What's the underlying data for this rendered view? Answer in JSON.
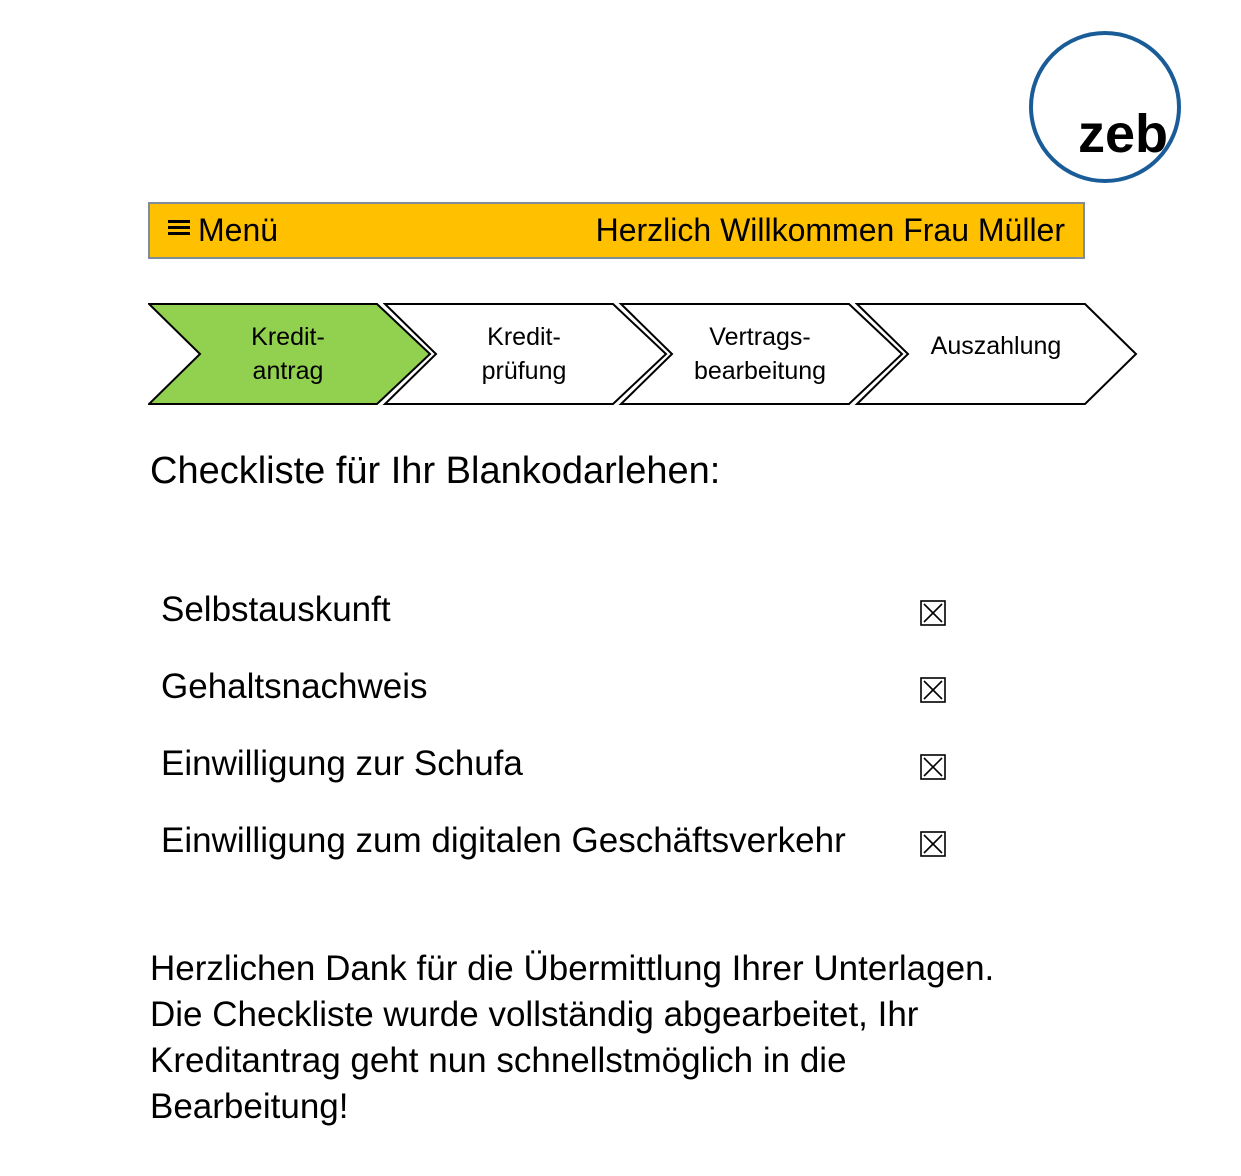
{
  "logo": {
    "text": "zeb",
    "ring_color": "#1a5c97"
  },
  "header": {
    "menu_label": "Menü",
    "welcome_text": "Herzlich Willkommen Frau Müller",
    "background_color": "#ffc000"
  },
  "steps": [
    {
      "label": "Kredit-\nantrag",
      "active": true
    },
    {
      "label": "Kredit-\nprüfung",
      "active": false
    },
    {
      "label": "Vertrags-\nbearbeitung",
      "active": false
    },
    {
      "label": "Auszahlung",
      "active": false
    }
  ],
  "step_active_color": "#92d050",
  "checklist": {
    "title": "Checkliste für Ihr Blankodarlehen:",
    "items": [
      {
        "label": "Selbstauskunft",
        "checked": true
      },
      {
        "label": "Gehaltsnachweis",
        "checked": true
      },
      {
        "label": "Einwilligung zur Schufa",
        "checked": true
      },
      {
        "label": "Einwilligung zum digitalen Geschäftsverkehr",
        "checked": true
      }
    ]
  },
  "message": {
    "lines": [
      "Herzlichen Dank für die Übermittlung Ihrer Unterlagen.",
      "Die Checkliste wurde vollständig abgearbeitet, Ihr",
      "Kreditantrag geht nun schnellstmöglich in die",
      "Bearbeitung!"
    ]
  }
}
